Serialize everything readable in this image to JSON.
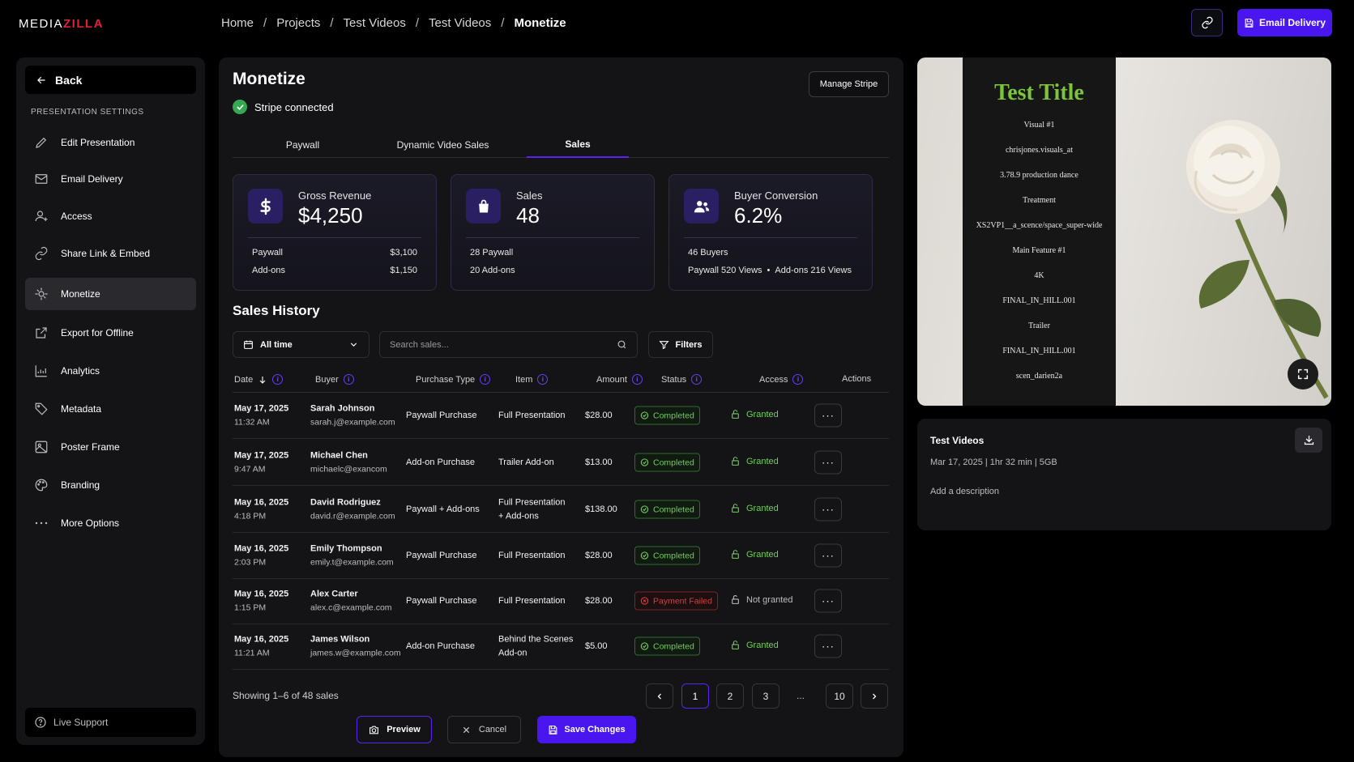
{
  "app": {
    "logo_left": "MEDIA",
    "logo_right": "ZILLA"
  },
  "breadcrumb": [
    "Home",
    "Projects",
    "Test Videos",
    "Test Videos",
    "Monetize"
  ],
  "breadcrumb_sep": "/",
  "header": {
    "email_delivery_label": "Email Delivery"
  },
  "sidebar": {
    "back_label": "Back",
    "section_title": "PRESENTATION SETTINGS",
    "items": [
      {
        "label": "Edit Presentation",
        "icon": "pencil-icon"
      },
      {
        "label": "Email Delivery",
        "icon": "mail-icon"
      },
      {
        "label": "Access",
        "icon": "user-access-icon"
      },
      {
        "label": "Share Link & Embed",
        "icon": "link-icon"
      },
      {
        "label": "Monetize",
        "icon": "monetize-icon",
        "active": true
      },
      {
        "label": "Export for Offline",
        "icon": "export-icon"
      },
      {
        "label": "Analytics",
        "icon": "analytics-icon"
      },
      {
        "label": "Metadata",
        "icon": "tag-icon"
      },
      {
        "label": "Poster Frame",
        "icon": "image-icon"
      },
      {
        "label": "Branding",
        "icon": "palette-icon"
      },
      {
        "label": "More Options",
        "icon": "more-icon"
      }
    ],
    "live_support_label": "Live Support"
  },
  "main": {
    "title": "Monetize",
    "stripe_status": "Stripe connected",
    "manage_stripe_label": "Manage Stripe",
    "tabs": [
      {
        "label": "Paywall"
      },
      {
        "label": "Dynamic Video Sales"
      },
      {
        "label": "Sales",
        "active": true
      }
    ],
    "cards": {
      "gross": {
        "label": "Gross Revenue",
        "value": "$4,250",
        "row1_label": "Paywall",
        "row1_value": "$3,100",
        "row2_label": "Add-ons",
        "row2_value": "$1,150"
      },
      "sales": {
        "label": "Sales",
        "value": "48",
        "row1": "28 Paywall",
        "row2": "20 Add-ons"
      },
      "conversion": {
        "label": "Buyer Conversion",
        "value": "6.2%",
        "row1": "46 Buyers",
        "row2_a": "Paywall 520 Views",
        "row2_sep": "•",
        "row2_b": "Add-ons 216 Views"
      }
    },
    "sales_history_title": "Sales History",
    "date_filter": "All time",
    "search_placeholder": "Search sales...",
    "filters_label": "Filters",
    "columns": {
      "date": "Date",
      "buyer": "Buyer",
      "purchase_type": "Purchase Type",
      "item": "Item",
      "amount": "Amount",
      "status": "Status",
      "access": "Access",
      "actions": "Actions"
    },
    "rows": [
      {
        "date": "May 17, 2025",
        "time": "11:32 AM",
        "name": "Sarah Johnson",
        "email": "sarah.j@example.com",
        "type": "Paywall Purchase",
        "item1": "Full Presentation",
        "item2": "",
        "amount": "$28.00",
        "status": "Completed",
        "status_ok": true,
        "access": "Granted",
        "access_ok": true
      },
      {
        "date": "May 17, 2025",
        "time": "9:47 AM",
        "name": "Michael Chen",
        "email": "michaelc@exancom",
        "type": "Add-on Purchase",
        "item1": "Trailer Add-on",
        "item2": "",
        "amount": "$13.00",
        "status": "Completed",
        "status_ok": true,
        "access": "Granted",
        "access_ok": true
      },
      {
        "date": "May 16, 2025",
        "time": "4:18 PM",
        "name": "David Rodriguez",
        "email": "david.r@example.com",
        "type": "Paywall + Add-ons",
        "item1": "Full Presentation",
        "item2": "+ Add-ons",
        "amount": "$138.00",
        "status": "Completed",
        "status_ok": true,
        "access": "Granted",
        "access_ok": true
      },
      {
        "date": "May 16, 2025",
        "time": "2:03 PM",
        "name": "Emily Thompson",
        "email": "emily.t@example.com",
        "type": "Paywall Purchase",
        "item1": "Full Presentation",
        "item2": "",
        "amount": "$28.00",
        "status": "Completed",
        "status_ok": true,
        "access": "Granted",
        "access_ok": true
      },
      {
        "date": "May 16, 2025",
        "time": "1:15 PM",
        "name": "Alex Carter",
        "email": "alex.c@example.com",
        "type": "Paywall Purchase",
        "item1": "Full Presentation",
        "item2": "",
        "amount": "$28.00",
        "status": "Payment Failed",
        "status_ok": false,
        "access": "Not granted",
        "access_ok": false
      },
      {
        "date": "May 16, 2025",
        "time": "11:21 AM",
        "name": "James Wilson",
        "email": "james.w@example.com",
        "type": "Add-on Purchase",
        "item1": "Behind the Scenes",
        "item2": "Add-on",
        "amount": "$5.00",
        "status": "Completed",
        "status_ok": true,
        "access": "Granted",
        "access_ok": true
      }
    ],
    "action_glyph": "···",
    "showing_text": "Showing 1–6 of 48 sales",
    "pagination": {
      "pages": [
        "1",
        "2",
        "3",
        "10"
      ],
      "ellipsis": "...",
      "current": "1"
    },
    "preview_label": "Preview",
    "cancel_label": "Cancel",
    "save_label": "Save Changes"
  },
  "preview": {
    "slate_title": "Test Title",
    "slate_lines": [
      "Visual #1",
      "chrisjones.visuals_at",
      "3.78.9 production dance",
      "Treatment",
      "XS2VP1__a_scence/space_super-wide",
      "Main Feature #1",
      "4K",
      "FINAL_IN_HILL.001",
      "Trailer",
      "FINAL_IN_HILL.001",
      "scen_darien2a"
    ]
  },
  "video_info": {
    "title": "Test Videos",
    "meta": "Mar 17, 2025 | 1hr 32 min | 5GB",
    "description_placeholder": "Add a description"
  },
  "colors": {
    "accent": "#4a16f0",
    "brand_red": "#e0203a",
    "success": "#6fcf5c",
    "error": "#e23b3b",
    "slate_title": "#7cc43a"
  }
}
